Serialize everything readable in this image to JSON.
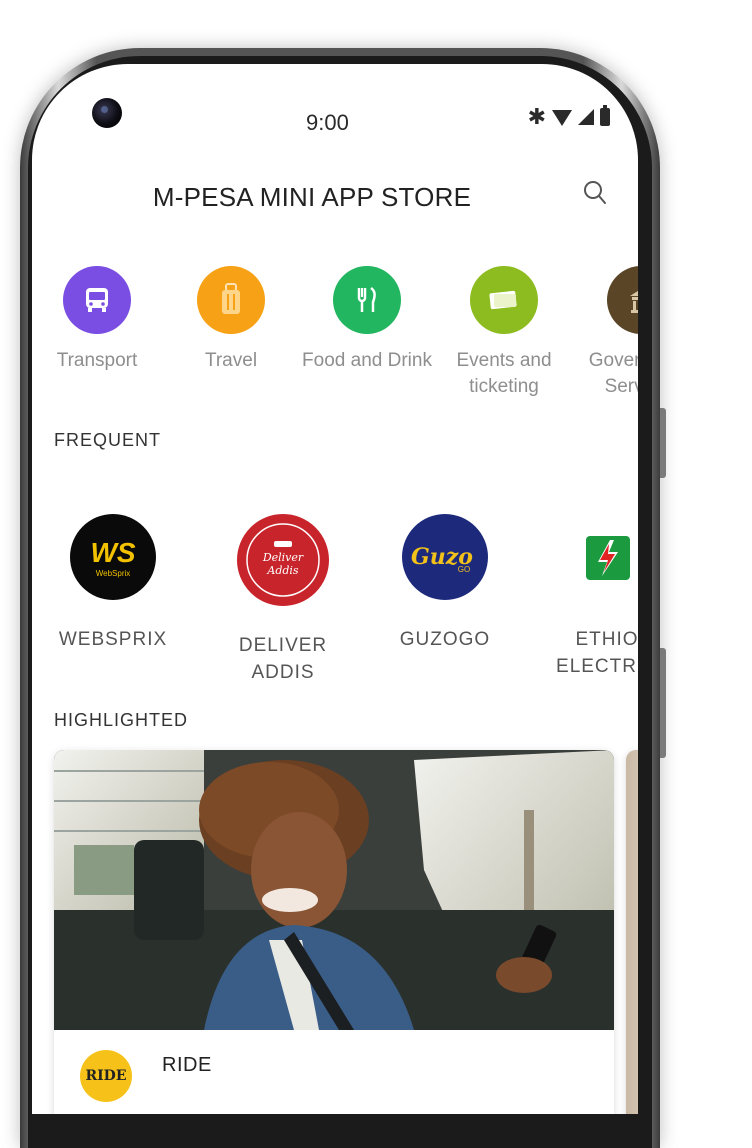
{
  "status_bar": {
    "time": "9:00"
  },
  "header": {
    "title": "M-PESA MINI APP STORE"
  },
  "categories": [
    {
      "label": "Transport",
      "color": "#7b4ee3",
      "icon": "bus-icon"
    },
    {
      "label": "Travel",
      "color": "#f7a116",
      "icon": "luggage-icon"
    },
    {
      "label": "Food and Drink",
      "color": "#21b65f",
      "icon": "cutlery-icon"
    },
    {
      "label": "Events and ticketing",
      "color": "#8cbc1f",
      "icon": "ticket-icon"
    },
    {
      "label": "Government Services",
      "color": "#5a4626",
      "icon": "government-building-icon"
    }
  ],
  "frequent": {
    "label": "FREQUENT",
    "items": [
      {
        "name": "WEBSPRIX",
        "logo_text": "WS",
        "logo_sub": "WebSprix"
      },
      {
        "name": "DELIVER ADDIS",
        "logo_text": "Deliver Addis"
      },
      {
        "name": "GUZOGO",
        "logo_text": "Guzo",
        "logo_sub": "GO"
      },
      {
        "name": "ETHIO ELECTRIC"
      }
    ]
  },
  "highlighted": {
    "label": "HIGHLIGHTED",
    "card": {
      "name": "RIDE",
      "logo_text": "RIDE"
    }
  },
  "colors": {
    "accent": "#2a2a2a"
  }
}
